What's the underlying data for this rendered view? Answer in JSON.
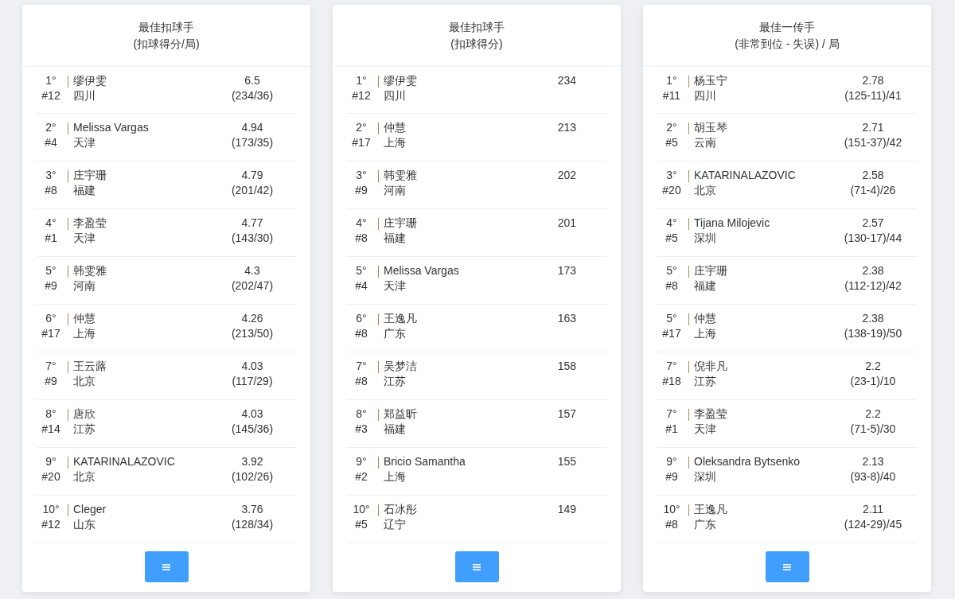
{
  "panels": [
    {
      "title": "最佳扣球手",
      "subtitle": "(扣球得分/局)",
      "rows": [
        {
          "rank": "1°",
          "number": "#12",
          "name": "缪伊雯",
          "team": "四川",
          "value": "6.5",
          "detail": "(234/36)"
        },
        {
          "rank": "2°",
          "number": "#4",
          "name": "Melissa Vargas",
          "team": "天津",
          "value": "4.94",
          "detail": "(173/35)"
        },
        {
          "rank": "3°",
          "number": "#8",
          "name": "庄宇珊",
          "team": "福建",
          "value": "4.79",
          "detail": "(201/42)"
        },
        {
          "rank": "4°",
          "number": "#1",
          "name": "李盈莹",
          "team": "天津",
          "value": "4.77",
          "detail": "(143/30)"
        },
        {
          "rank": "5°",
          "number": "#9",
          "name": "韩雯雅",
          "team": "河南",
          "value": "4.3",
          "detail": "(202/47)"
        },
        {
          "rank": "6°",
          "number": "#17",
          "name": "仲慧",
          "team": "上海",
          "value": "4.26",
          "detail": "(213/50)"
        },
        {
          "rank": "7°",
          "number": "#9",
          "name": "王云蕗",
          "team": "北京",
          "value": "4.03",
          "detail": "(117/29)"
        },
        {
          "rank": "8°",
          "number": "#14",
          "name": "唐欣",
          "team": "江苏",
          "value": "4.03",
          "detail": "(145/36)"
        },
        {
          "rank": "9°",
          "number": "#20",
          "name": "KATARINALAZOVIC",
          "team": "北京",
          "value": "3.92",
          "detail": "(102/26)"
        },
        {
          "rank": "10°",
          "number": "#12",
          "name": "Cleger",
          "team": "山东",
          "value": "3.76",
          "detail": "(128/34)"
        }
      ]
    },
    {
      "title": "最佳扣球手",
      "subtitle": "(扣球得分)",
      "rows": [
        {
          "rank": "1°",
          "number": "#12",
          "name": "缪伊雯",
          "team": "四川",
          "value": "234"
        },
        {
          "rank": "2°",
          "number": "#17",
          "name": "仲慧",
          "team": "上海",
          "value": "213"
        },
        {
          "rank": "3°",
          "number": "#9",
          "name": "韩雯雅",
          "team": "河南",
          "value": "202"
        },
        {
          "rank": "4°",
          "number": "#8",
          "name": "庄宇珊",
          "team": "福建",
          "value": "201"
        },
        {
          "rank": "5°",
          "number": "#4",
          "name": "Melissa Vargas",
          "team": "天津",
          "value": "173"
        },
        {
          "rank": "6°",
          "number": "#8",
          "name": "王逸凡",
          "team": "广东",
          "value": "163"
        },
        {
          "rank": "7°",
          "number": "#8",
          "name": "吴梦洁",
          "team": "江苏",
          "value": "158"
        },
        {
          "rank": "8°",
          "number": "#3",
          "name": "郑益昕",
          "team": "福建",
          "value": "157"
        },
        {
          "rank": "9°",
          "number": "#2",
          "name": "Bricio Samantha",
          "team": "上海",
          "value": "155"
        },
        {
          "rank": "10°",
          "number": "#5",
          "name": "石冰彤",
          "team": "辽宁",
          "value": "149"
        }
      ]
    },
    {
      "title": "最佳一传手",
      "subtitle": "(非常到位 - 失误) / 局",
      "rows": [
        {
          "rank": "1°",
          "number": "#11",
          "name": "杨玉宁",
          "team": "四川",
          "value": "2.78",
          "detail": "(125-11)/41"
        },
        {
          "rank": "2°",
          "number": "#5",
          "name": "胡玉琴",
          "team": "云南",
          "value": "2.71",
          "detail": "(151-37)/42"
        },
        {
          "rank": "3°",
          "number": "#20",
          "name": "KATARINALAZOVIC",
          "team": "北京",
          "value": "2.58",
          "detail": "(71-4)/26"
        },
        {
          "rank": "4°",
          "number": "#5",
          "name": "Tijana Milojevic",
          "team": "深圳",
          "value": "2.57",
          "detail": "(130-17)/44"
        },
        {
          "rank": "5°",
          "number": "#8",
          "name": "庄宇珊",
          "team": "福建",
          "value": "2.38",
          "detail": "(112-12)/42"
        },
        {
          "rank": "5°",
          "number": "#17",
          "name": "仲慧",
          "team": "上海",
          "value": "2.38",
          "detail": "(138-19)/50"
        },
        {
          "rank": "7°",
          "number": "#18",
          "name": "倪非凡",
          "team": "江苏",
          "value": "2.2",
          "detail": "(23-1)/10"
        },
        {
          "rank": "7°",
          "number": "#1",
          "name": "李盈莹",
          "team": "天津",
          "value": "2.2",
          "detail": "(71-5)/30"
        },
        {
          "rank": "9°",
          "number": "#9",
          "name": "Oleksandra Bytsenko",
          "team": "深圳",
          "value": "2.13",
          "detail": "(93-8)/40"
        },
        {
          "rank": "10°",
          "number": "#8",
          "name": "王逸凡",
          "team": "广东",
          "value": "2.11",
          "detail": "(124-29)/45"
        }
      ]
    }
  ]
}
